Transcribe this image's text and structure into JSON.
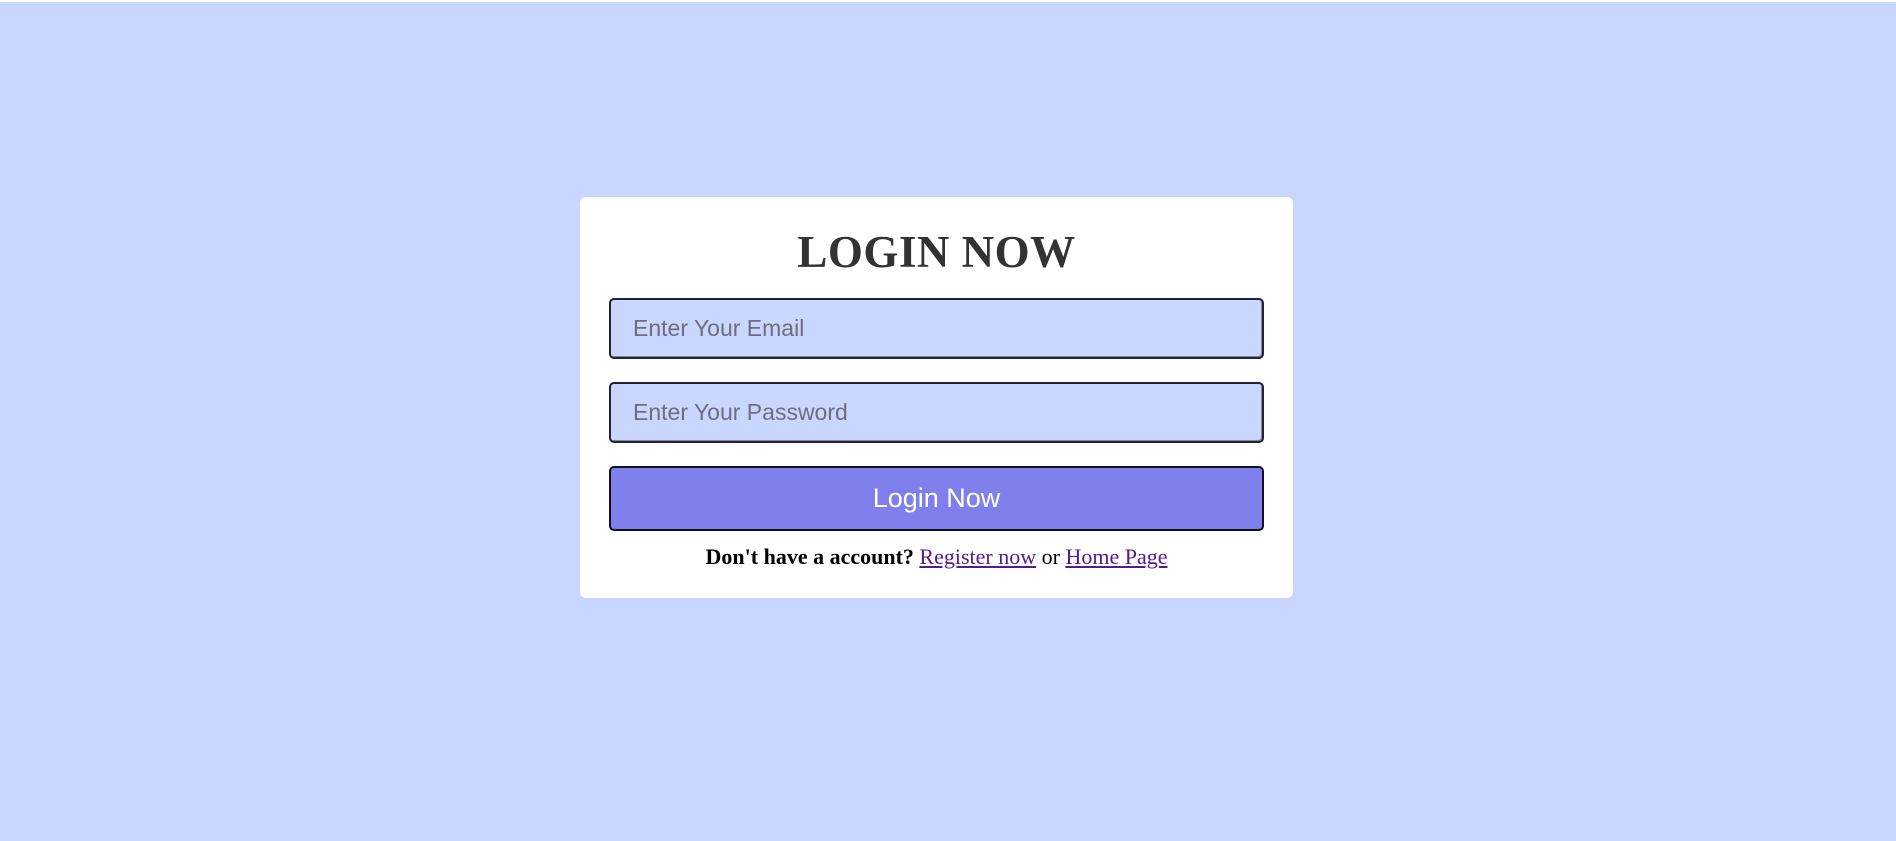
{
  "colors": {
    "background": "#c9d6ff",
    "card": "#ffffff",
    "button": "#7f80ec",
    "link": "#551a8b"
  },
  "login_form": {
    "title": "LOGIN NOW",
    "email_placeholder": "Enter Your Email",
    "password_placeholder": "Enter Your Password",
    "submit_label": "Login Now",
    "footer_question": "Don't have a account?",
    "register_link": "Register now",
    "separator": "or",
    "home_link": "Home Page"
  }
}
